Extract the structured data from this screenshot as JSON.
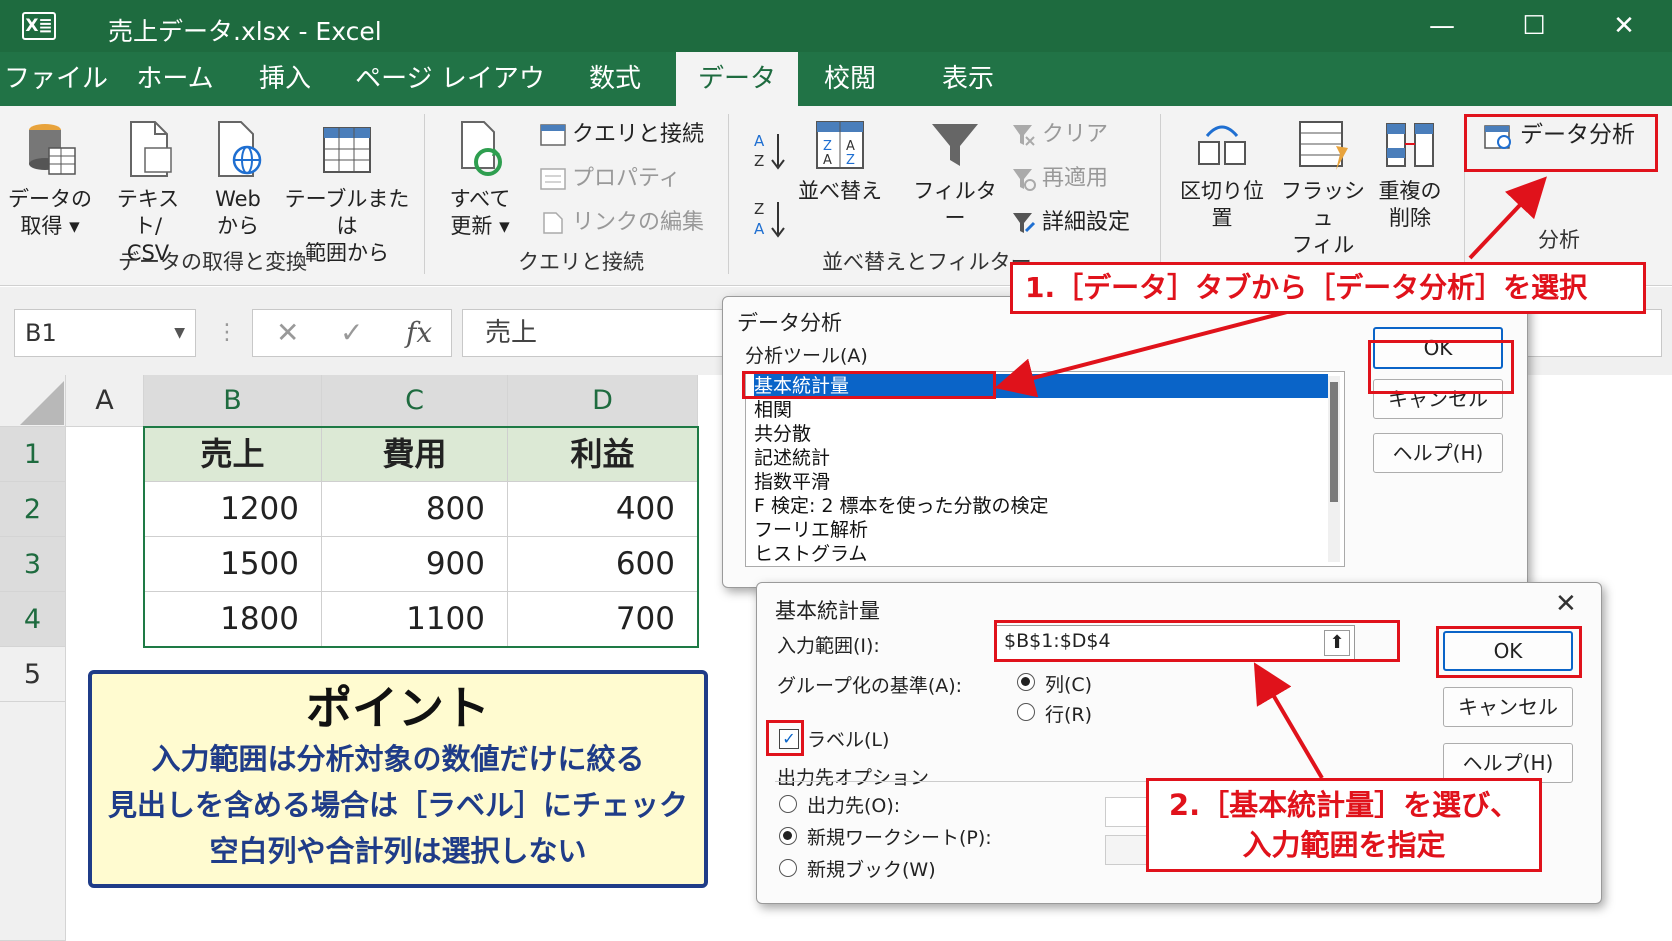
{
  "window": {
    "logo": "X≣",
    "title": "売上データ.xlsx  -  Excel",
    "minimize": "—",
    "maximize": "☐",
    "close": "✕"
  },
  "tabs": [
    "ファイル",
    "ホーム",
    "挿入",
    "ページ レイアウト",
    "数式",
    "データ",
    "校閲",
    "表示"
  ],
  "ribbon": {
    "get_data": [
      "データの",
      "取得 ▾"
    ],
    "text_csv": [
      "テキスト/",
      "CSV"
    ],
    "web": [
      "Web",
      "から"
    ],
    "from_table": [
      "テーブルまたは",
      "範囲から"
    ],
    "group_get": "データの取得と変換",
    "refresh_all": [
      "すべて",
      "更新 ▾"
    ],
    "queries_conn": "クエリと接続",
    "properties": "プロパティ",
    "edit_links": "リンクの編集",
    "group_queries": "クエリと接続",
    "sort_label": "並べ替え",
    "filter_label": "フィルター",
    "clear": "クリア",
    "reapply": "再適用",
    "advanced": "詳細設定",
    "group_sort": "並べ替えとフィルター",
    "text_to_columns": "区切り位置",
    "flash_fill": [
      "フラッシュ",
      "フィル"
    ],
    "remove_dup": [
      "重複の",
      "削除"
    ],
    "data_analysis": "データ分析",
    "group_analysis": "分析"
  },
  "formula_bar": {
    "name_box": "B1",
    "cancel": "✕",
    "enter": "✓",
    "fx": "fx",
    "content": "売上"
  },
  "sheet": {
    "columns": [
      "A",
      "B",
      "C",
      "D"
    ],
    "rows": [
      "1",
      "2",
      "3",
      "4",
      "5"
    ],
    "table": {
      "headers": [
        "売上",
        "費用",
        "利益"
      ],
      "rows": [
        [
          "1200",
          "800",
          "400"
        ],
        [
          "1500",
          "900",
          "600"
        ],
        [
          "1800",
          "1100",
          "700"
        ]
      ]
    }
  },
  "point_box": {
    "title": "ポイント",
    "lines": [
      "入力範囲は分析対象の数値だけに絞る",
      "見出しを含める場合は［ラベル］にチェック",
      "空白列や合計列は選択しない"
    ]
  },
  "analysis_dialog": {
    "title": "データ分析",
    "tools_label": "分析ツール(A)",
    "tools": [
      "基本統計量",
      "相関",
      "共分散",
      "記述統計",
      "指数平滑",
      "F 検定: 2 標本を使った分散の検定",
      "フーリエ解析",
      "ヒストグラム"
    ],
    "ok": "OK",
    "cancel": "キャンセル",
    "help": "ヘルプ(H)"
  },
  "stats_dialog": {
    "title": "基本統計量",
    "close": "✕",
    "input_range_label": "入力範囲(I):",
    "input_range_value": "$B$1:$D$4",
    "group_label": "グループ化の基準(A):",
    "group_columns": "列(C)",
    "group_rows": "行(R)",
    "labels_checkbox": "ラベル(L)",
    "output_options": "出力先オプション",
    "output_range": "出力先(O):",
    "new_sheet": "新規ワークシート(P):",
    "new_book": "新規ブック(W)",
    "ok": "OK",
    "cancel": "キャンセル",
    "help": "ヘルプ(H)"
  },
  "callouts": {
    "step1": "1.［データ］タブから［データ分析］を選択",
    "step2_line1": "2.［基本統計量］を選び、",
    "step2_line2": "入力範囲を指定"
  },
  "colors": {
    "excel_green": "#217346",
    "title_green": "#1e6b3f",
    "highlight_red": "#e0121b",
    "selection_blue": "#0a64c8",
    "header_fill": "#dce9d5",
    "point_fill": "#fffbd0",
    "point_text": "#1f3c88"
  }
}
